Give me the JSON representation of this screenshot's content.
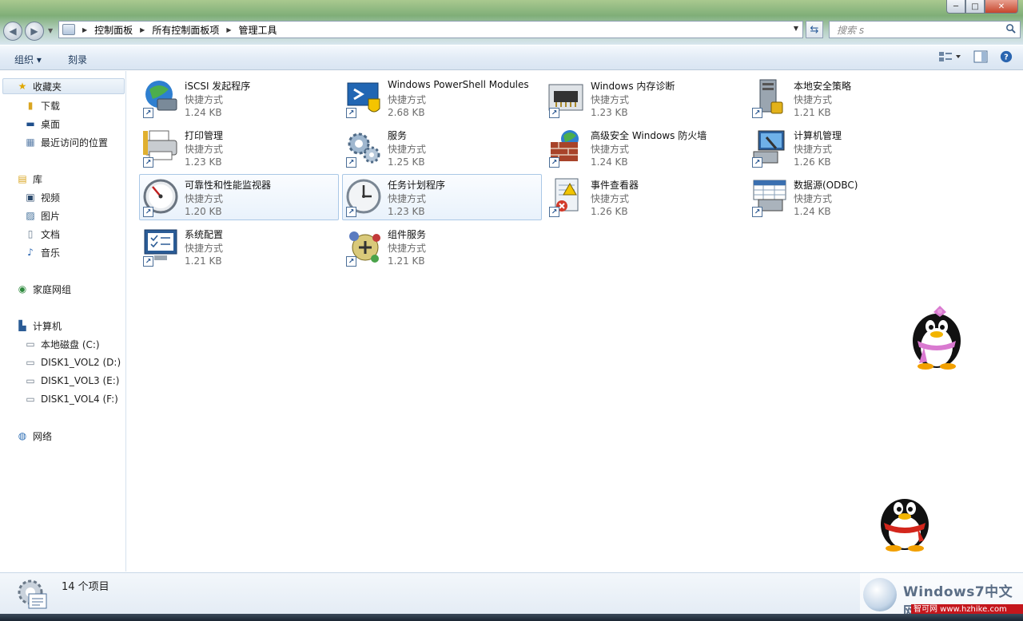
{
  "window": {
    "controls": {
      "minimize": "─",
      "maximize": "□",
      "close": "✕"
    }
  },
  "address_bar": {
    "breadcrumbs": [
      "控制面板",
      "所有控制面板项",
      "管理工具"
    ]
  },
  "search": {
    "placeholder": "搜索 s"
  },
  "toolbar": {
    "organize_label": "组织 ▾",
    "burn_label": "刻录"
  },
  "sidebar": {
    "favorites": {
      "label": "收藏夹",
      "items": [
        "下载",
        "桌面",
        "最近访问的位置"
      ]
    },
    "libraries": {
      "label": "库",
      "items": [
        "视频",
        "图片",
        "文档",
        "音乐"
      ]
    },
    "homegroup": {
      "label": "家庭网组"
    },
    "computer": {
      "label": "计算机",
      "items": [
        "本地磁盘 (C:)",
        "DISK1_VOL2 (D:)",
        "DISK1_VOL3 (E:)",
        "DISK1_VOL4 (F:)"
      ]
    },
    "network": {
      "label": "网络"
    }
  },
  "files": [
    {
      "name": "iSCSI 发起程序",
      "type": "快捷方式",
      "size": "1.24 KB",
      "icon": "iscsi-icon"
    },
    {
      "name": "Windows PowerShell Modules",
      "type": "快捷方式",
      "size": "2.68 KB",
      "icon": "powershell-icon"
    },
    {
      "name": "Windows 内存诊断",
      "type": "快捷方式",
      "size": "1.23 KB",
      "icon": "memory-diagnostic-icon"
    },
    {
      "name": "本地安全策略",
      "type": "快捷方式",
      "size": "1.21 KB",
      "icon": "security-policy-icon"
    },
    {
      "name": "打印管理",
      "type": "快捷方式",
      "size": "1.23 KB",
      "icon": "print-management-icon"
    },
    {
      "name": "服务",
      "type": "快捷方式",
      "size": "1.25 KB",
      "icon": "services-icon"
    },
    {
      "name": "高级安全 Windows 防火墙",
      "type": "快捷方式",
      "size": "1.24 KB",
      "icon": "firewall-icon"
    },
    {
      "name": "计算机管理",
      "type": "快捷方式",
      "size": "1.26 KB",
      "icon": "computer-management-icon"
    },
    {
      "name": "可靠性和性能监视器",
      "type": "快捷方式",
      "size": "1.20 KB",
      "icon": "performance-monitor-icon"
    },
    {
      "name": "任务计划程序",
      "type": "快捷方式",
      "size": "1.23 KB",
      "icon": "task-scheduler-icon"
    },
    {
      "name": "事件查看器",
      "type": "快捷方式",
      "size": "1.26 KB",
      "icon": "event-viewer-icon"
    },
    {
      "name": "数据源(ODBC)",
      "type": "快捷方式",
      "size": "1.24 KB",
      "icon": "odbc-icon"
    },
    {
      "name": "系统配置",
      "type": "快捷方式",
      "size": "1.21 KB",
      "icon": "system-configuration-icon"
    },
    {
      "name": "组件服务",
      "type": "快捷方式",
      "size": "1.21 KB",
      "icon": "component-services-icon"
    }
  ],
  "status": {
    "item_count": "14 个项目"
  },
  "watermark": {
    "brand": "Windows7中文网",
    "site": "智可网 www.hzhike.com"
  }
}
